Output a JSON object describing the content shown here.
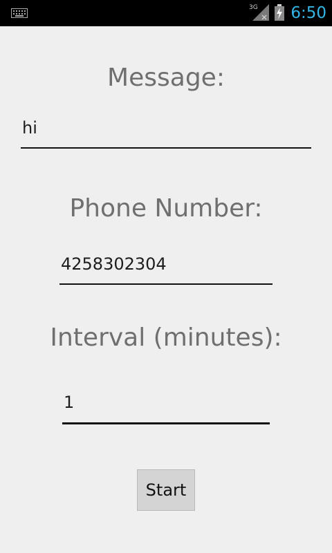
{
  "status_bar": {
    "network": "3G",
    "time": "6:50",
    "time_color": "#33b5e5",
    "icons": [
      "keyboard-icon",
      "signal-icon",
      "battery-icon"
    ]
  },
  "form": {
    "message_label": "Message:",
    "message_value": "hi",
    "phone_label": "Phone Number:",
    "phone_value": "4258302304",
    "interval_label": "Interval (minutes):",
    "interval_value": "1",
    "start_button": "Start"
  }
}
